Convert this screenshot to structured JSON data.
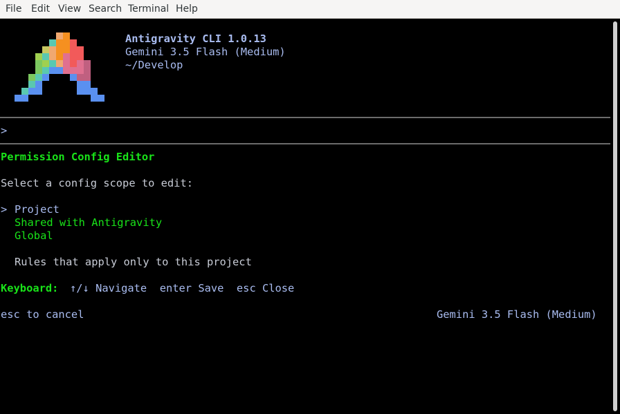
{
  "menubar": {
    "items": [
      "File",
      "Edit",
      "View",
      "Search",
      "Terminal",
      "Help"
    ]
  },
  "header": {
    "app_name": "Antigravity CLI 1.0.13",
    "model": "Gemini 3.5 Flash (Medium)",
    "directory": "~/Develop"
  },
  "prompt": {
    "symbol": ">"
  },
  "editor": {
    "title": "Permission Config Editor",
    "instruction": "Select a config scope to edit:",
    "cursor": ">",
    "options": [
      "Project",
      "Shared with Antigravity",
      "Global"
    ],
    "selected_index": 0,
    "description": "Rules that apply only to this project",
    "keyboard_label": "Keyboard:",
    "keyboard_hints": "↑/↓ Navigate  enter Save  esc Close"
  },
  "footer": {
    "left": "esc to cancel",
    "right": "Gemini 3.5 Flash (Medium)"
  },
  "colors": {
    "background": "#000000",
    "text_blue": "#a9bcf0",
    "accent_green": "#19e319",
    "rule_gray": "#6b6b6b"
  },
  "icons": {
    "logo": "antigravity-logo-pixel-art"
  }
}
